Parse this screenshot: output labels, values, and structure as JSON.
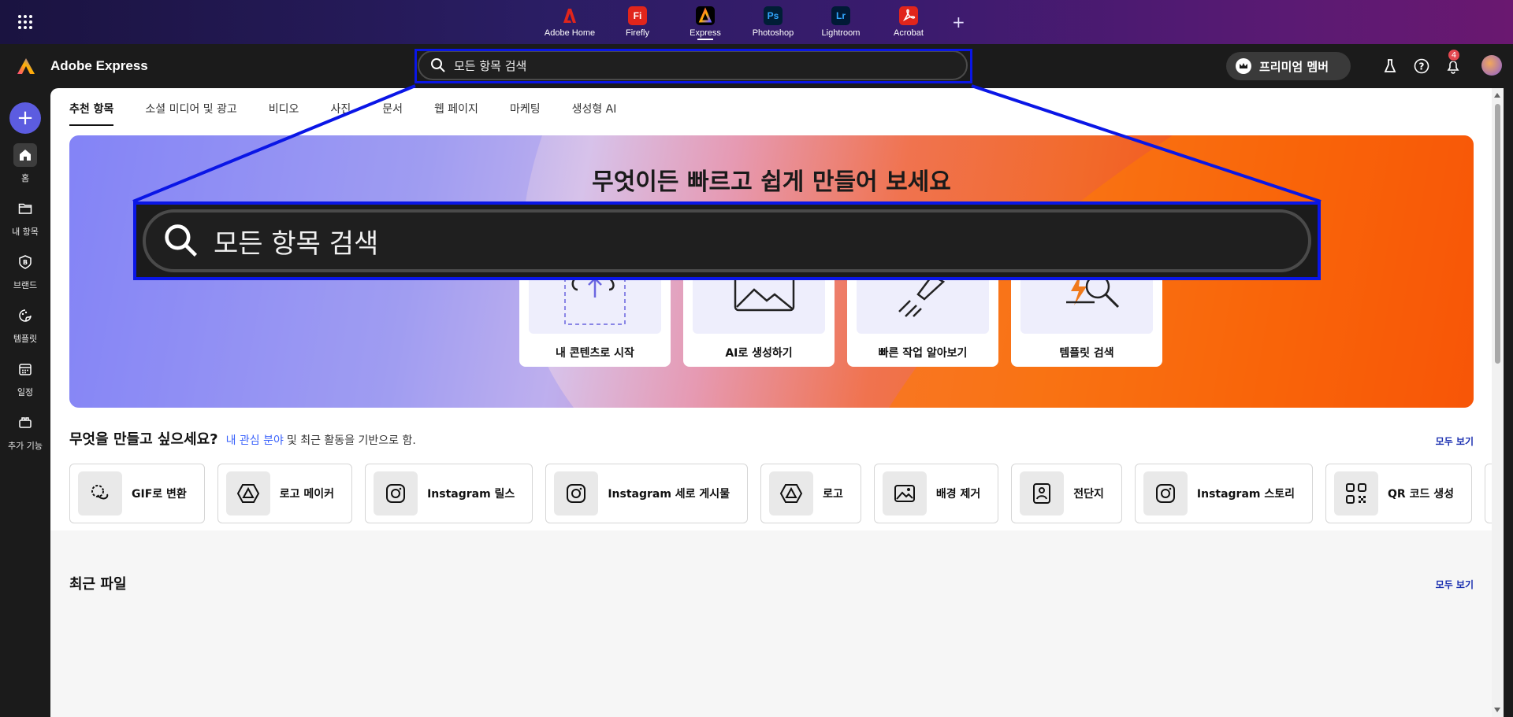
{
  "app_switcher": {
    "apps": [
      {
        "label": "Adobe Home",
        "icon": "adobe-logo-icon",
        "color": "#e1251b",
        "glyph": ""
      },
      {
        "label": "Firefly",
        "icon": "firefly-icon",
        "color": "#e1251b",
        "glyph": "Fi"
      },
      {
        "label": "Express",
        "icon": "express-icon",
        "color": "#000000",
        "glyph": ""
      },
      {
        "label": "Photoshop",
        "icon": "photoshop-icon",
        "color": "#001e36",
        "glyph": "Ps"
      },
      {
        "label": "Lightroom",
        "icon": "lightroom-icon",
        "color": "#001a36",
        "glyph": "Lr"
      },
      {
        "label": "Acrobat",
        "icon": "acrobat-icon",
        "color": "#e1251b",
        "glyph": ""
      }
    ],
    "active": "Express"
  },
  "header": {
    "brand": "Adobe Express",
    "search_placeholder": "모든 항목 검색",
    "premium_label": "프리미엄 멤버",
    "notification_count": "4"
  },
  "rail": {
    "items": [
      {
        "label": "홈",
        "icon": "home-icon"
      },
      {
        "label": "내 항목",
        "icon": "folder-icon"
      },
      {
        "label": "브랜드",
        "icon": "brand-icon"
      },
      {
        "label": "템플릿",
        "icon": "template-icon"
      },
      {
        "label": "일정",
        "icon": "calendar-icon"
      },
      {
        "label": "추가 기능",
        "icon": "add-ons-icon"
      }
    ]
  },
  "tabs": [
    "추천 항목",
    "소셜 미디어 및 광고",
    "비디오",
    "사진",
    "문서",
    "웹 페이지",
    "마케팅",
    "생성형 AI"
  ],
  "hero": {
    "title": "무엇이든 빠르고 쉽게 만들어 보세요",
    "zoom_search_text": "모든 항목 검색",
    "cards": [
      {
        "label": "내 콘텐츠로 시작",
        "icon": "upload-icon"
      },
      {
        "label": "AI로 생성하기",
        "icon": "image-generate-icon"
      },
      {
        "label": "빠른 작업 알아보기",
        "icon": "quick-actions-icon"
      },
      {
        "label": "템플릿 검색",
        "icon": "template-search-icon"
      }
    ]
  },
  "create": {
    "heading": "무엇을 만들고 싶으세요?",
    "link": "내 관심 분야",
    "rest": "및 최근 활동을 기반으로 함.",
    "see_all": "모두 보기",
    "items": [
      {
        "label": "GIF로 변환",
        "icon": "gif-convert-icon"
      },
      {
        "label": "로고 메이커",
        "icon": "logo-maker-icon"
      },
      {
        "label": "Instagram 릴스",
        "icon": "instagram-icon"
      },
      {
        "label": "Instagram 세로 게시물",
        "icon": "instagram-icon"
      },
      {
        "label": "로고",
        "icon": "logo-icon"
      },
      {
        "label": "배경 제거",
        "icon": "remove-background-icon"
      },
      {
        "label": "전단지",
        "icon": "flyer-icon"
      },
      {
        "label": "Instagram 스토리",
        "icon": "instagram-icon"
      },
      {
        "label": "QR 코드 생성",
        "icon": "qr-code-icon"
      },
      {
        "label": "",
        "icon": "presentation-icon"
      }
    ]
  },
  "recent": {
    "title": "최근 파일",
    "see_all": "모두 보기"
  },
  "colors": {
    "accent": "#5c5ce0",
    "highlight_box": "#0a16e6",
    "link": "#3b63fb"
  }
}
